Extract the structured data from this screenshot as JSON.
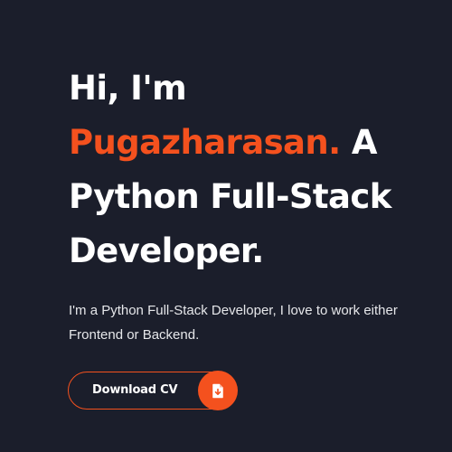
{
  "hero": {
    "greeting": "Hi, I'm",
    "name": "Pugazharasan.",
    "article": " A",
    "role_line1": "Python Full-Stack",
    "role_line2": "Developer.",
    "description": "I'm a Python Full-Stack Developer, I love to work either Frontend or Backend."
  },
  "cta": {
    "download_label": "Download CV",
    "icon": "file-download-icon"
  },
  "colors": {
    "background": "#1b1e2b",
    "accent": "#f4511e",
    "text": "#ffffff"
  }
}
